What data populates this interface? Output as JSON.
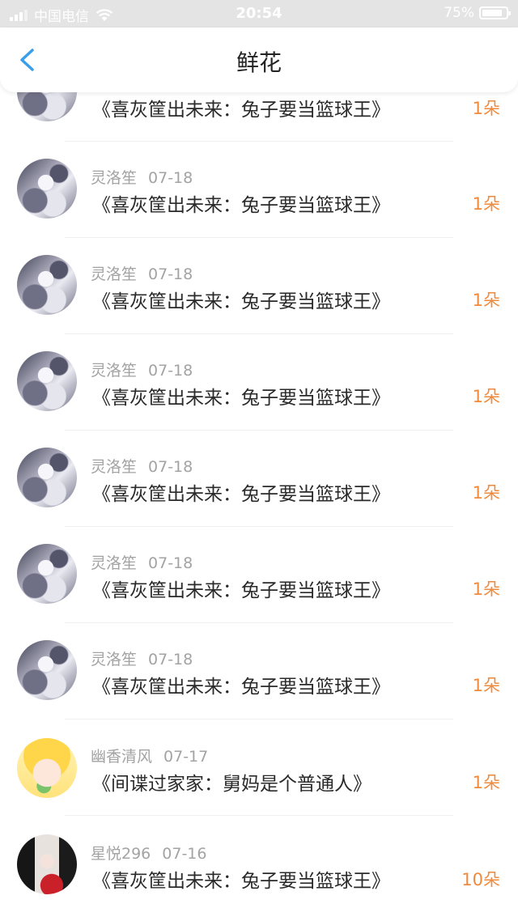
{
  "status_bar": {
    "carrier": "中国电信",
    "time": "20:54",
    "battery": "75%",
    "battery_level": 0.75
  },
  "nav": {
    "title": "鲜花",
    "back_icon": "chevron-left-icon",
    "accent": "#3a9ee8"
  },
  "colors": {
    "count": "#f08a3c",
    "meta": "#a3a3a3"
  },
  "rows": [
    {
      "avatar": "gray",
      "name": "",
      "date": "",
      "book": "《喜灰筐出未来：兔子要当篮球王》",
      "count": "1朵"
    },
    {
      "avatar": "gray",
      "name": "灵洛笙",
      "date": "07-18",
      "book": "《喜灰筐出未来：兔子要当篮球王》",
      "count": "1朵"
    },
    {
      "avatar": "gray",
      "name": "灵洛笙",
      "date": "07-18",
      "book": "《喜灰筐出未来：兔子要当篮球王》",
      "count": "1朵"
    },
    {
      "avatar": "gray",
      "name": "灵洛笙",
      "date": "07-18",
      "book": "《喜灰筐出未来：兔子要当篮球王》",
      "count": "1朵"
    },
    {
      "avatar": "gray",
      "name": "灵洛笙",
      "date": "07-18",
      "book": "《喜灰筐出未来：兔子要当篮球王》",
      "count": "1朵"
    },
    {
      "avatar": "gray",
      "name": "灵洛笙",
      "date": "07-18",
      "book": "《喜灰筐出未来：兔子要当篮球王》",
      "count": "1朵"
    },
    {
      "avatar": "gray",
      "name": "灵洛笙",
      "date": "07-18",
      "book": "《喜灰筐出未来：兔子要当篮球王》",
      "count": "1朵"
    },
    {
      "avatar": "yellow",
      "name": "幽香清风",
      "date": "07-17",
      "book": "《间谍过家家：舅妈是个普通人》",
      "count": "1朵"
    },
    {
      "avatar": "dark",
      "name": "星悦296",
      "date": "07-16",
      "book": "《喜灰筐出未来：兔子要当篮球王》",
      "count": "10朵"
    }
  ]
}
